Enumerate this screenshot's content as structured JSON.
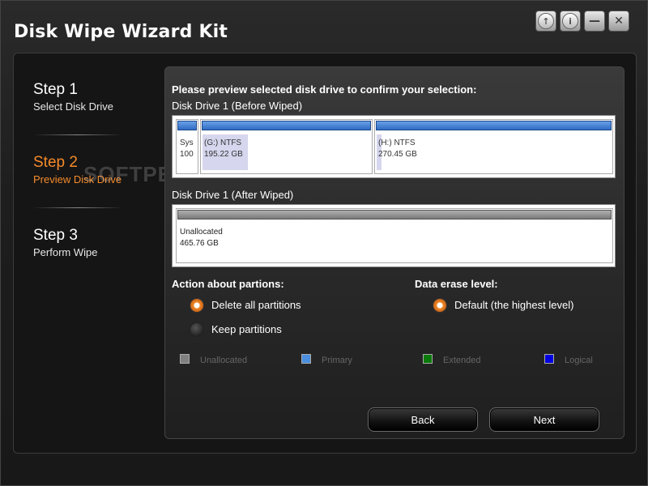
{
  "window": {
    "title": "Disk Wipe Wizard Kit",
    "controls": [
      {
        "name": "update-icon",
        "glyph": "↑"
      },
      {
        "name": "info-icon",
        "glyph": "i"
      },
      {
        "name": "minimize-icon",
        "glyph": "—"
      },
      {
        "name": "close-icon",
        "glyph": "✕"
      }
    ]
  },
  "watermark": "SOFTPEDIA",
  "sidebar": {
    "steps": [
      {
        "title": "Step 1",
        "subtitle": "Select Disk Drive",
        "active": false
      },
      {
        "title": "Step 2",
        "subtitle": "Preview Disk Drive",
        "active": true
      },
      {
        "title": "Step 3",
        "subtitle": "Perform Wipe",
        "active": false
      }
    ]
  },
  "main": {
    "instruction": "Please preview selected disk drive to confirm your selection:",
    "before_label": "Disk Drive 1 (Before Wiped)",
    "before_partitions": [
      {
        "line1": "Sys",
        "line2": "100"
      },
      {
        "line1": " (G:)  NTFS",
        "line2": "195.22 GB"
      },
      {
        "line1": " (H:)  NTFS",
        "line2": "270.45 GB"
      }
    ],
    "after_label": "Disk Drive 1 (After Wiped)",
    "after_partition": {
      "line1": "Unallocated",
      "line2": "465.76 GB"
    },
    "action_heading": "Action about partions:",
    "action_options": [
      {
        "label": "Delete all partitions",
        "selected": true
      },
      {
        "label": "Keep partitions",
        "selected": false
      }
    ],
    "erase_heading": "Data erase level:",
    "erase_option": {
      "label": "Default (the highest level)",
      "selected": true
    },
    "legend": [
      {
        "label": "Unallocated",
        "color": "#808080"
      },
      {
        "label": "Primary",
        "color": "#4a8fe0"
      },
      {
        "label": "Extended",
        "color": "#0a7a0a"
      },
      {
        "label": "Logical",
        "color": "#0000e0"
      }
    ],
    "buttons": {
      "back": "Back",
      "next": "Next"
    }
  },
  "colors": {
    "accent": "#f58a2a",
    "partition_bar": "#2f6cc4"
  }
}
